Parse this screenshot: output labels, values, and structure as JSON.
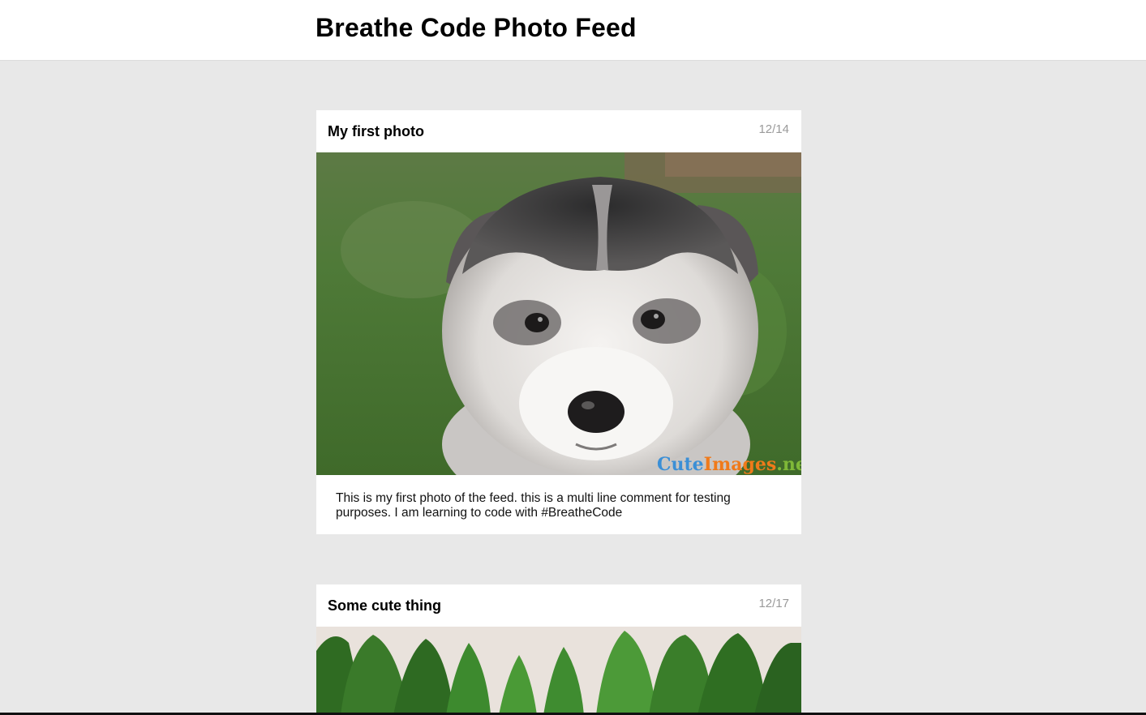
{
  "header": {
    "title": "Breathe Code Photo Feed"
  },
  "posts": [
    {
      "title": "My first photo",
      "date": "12/14",
      "caption_text": "This is my first photo of the feed. this is a multi line comment for testing purposes. I am learning to code with",
      "hashtag": "#BreatheCode",
      "watermark": {
        "part1": "Cute",
        "part2": "Images",
        "part3": ".net",
        "color1": "#3b8fd6",
        "color2": "#f07a1a",
        "color3": "#7fb838"
      }
    },
    {
      "title": "Some cute thing",
      "date": "12/17"
    }
  ],
  "colors": {
    "page_background": "#e8e8e8",
    "card_background": "#ffffff",
    "date_gray": "#9a9a9a"
  }
}
